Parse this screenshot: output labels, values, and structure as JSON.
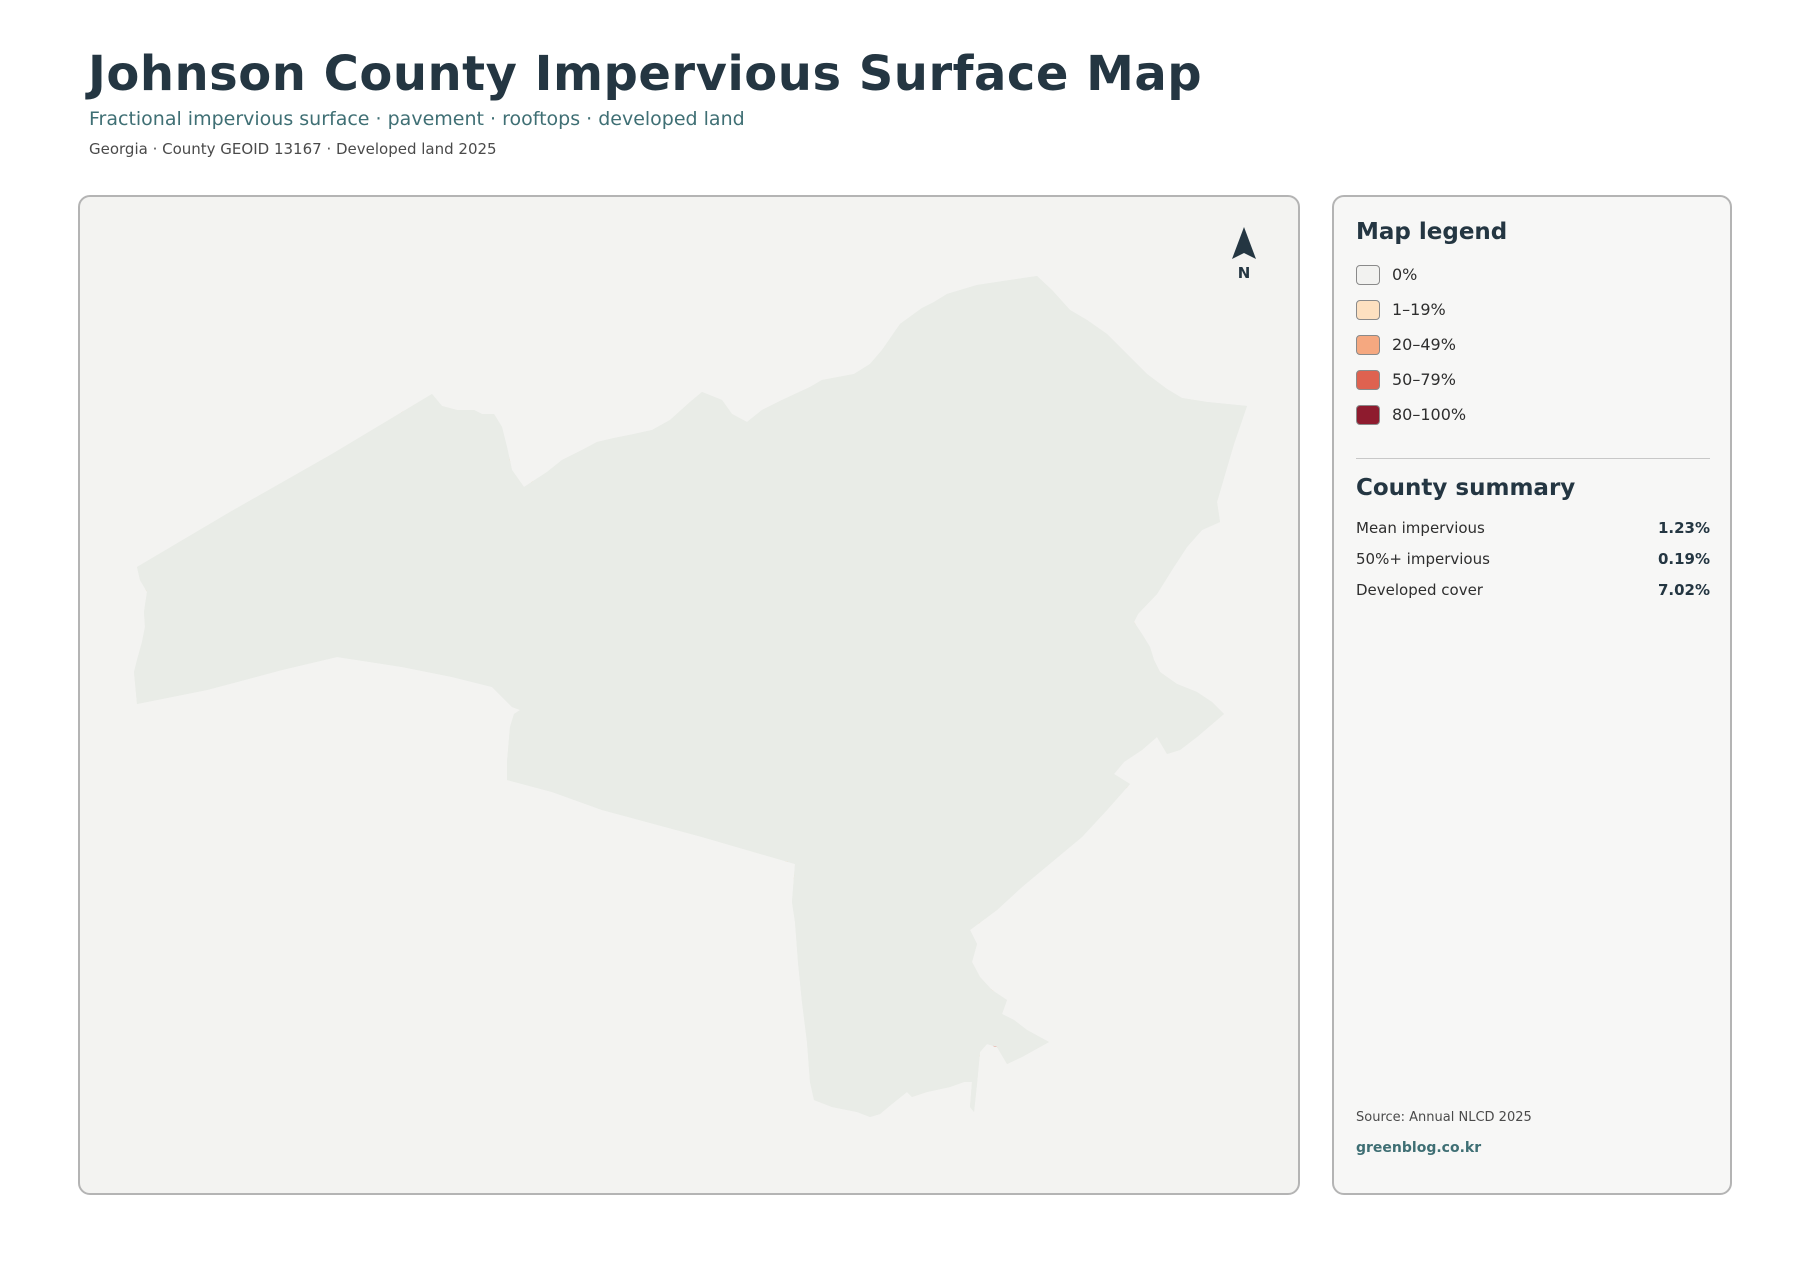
{
  "header": {
    "title": "Johnson County Impervious Surface Map",
    "subtitle": "Fractional impervious surface · pavement · rooftops · developed land",
    "meta": "Georgia · County GEOID 13167 · Developed land 2025"
  },
  "map": {
    "north_label": "N",
    "colors": {
      "county_fill": "#e9ece7",
      "county_outline": "#243642",
      "road_low": "#f6c39a",
      "road_mid": "#f0a070",
      "urban_high": "#e0604a",
      "urban_core": "#8e1b2e"
    }
  },
  "legend": {
    "title": "Map legend",
    "items": [
      {
        "label": "0%",
        "color": "#f2f2f0"
      },
      {
        "label": "1–19%",
        "color": "#fde0c0"
      },
      {
        "label": "20–49%",
        "color": "#f5a880"
      },
      {
        "label": "50–79%",
        "color": "#de6250"
      },
      {
        "label": "80–100%",
        "color": "#8e1b2e"
      }
    ]
  },
  "summary": {
    "title": "County summary",
    "rows": [
      {
        "label": "Mean impervious",
        "value": "1.23%"
      },
      {
        "label": "50%+ impervious",
        "value": "0.19%"
      },
      {
        "label": "Developed cover",
        "value": "7.02%"
      }
    ]
  },
  "footer": {
    "source": "Source: Annual NLCD 2025",
    "site": "greenblog.co.kr"
  }
}
